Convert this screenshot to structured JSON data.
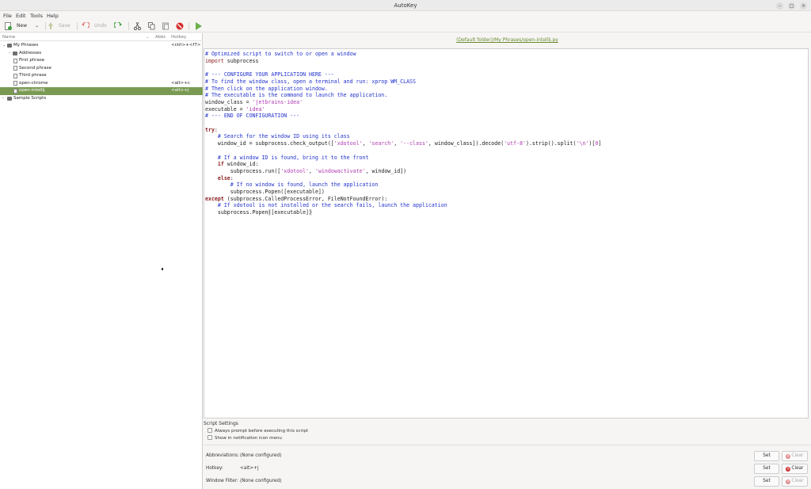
{
  "window": {
    "title": "AutoKey"
  },
  "menu": [
    "File",
    "Edit",
    "Tools",
    "Help"
  ],
  "toolbar": {
    "new_label": "New",
    "save_label": "Save",
    "undo_label": "Undo"
  },
  "tree": {
    "columns": {
      "name": "Name",
      "abbr": "Abbr.",
      "hotkey": "Hotkey"
    },
    "rows": [
      {
        "label": "My Phrases",
        "hotkey": "<ctrl>+<f7>"
      },
      {
        "label": "Addresses",
        "hotkey": ""
      },
      {
        "label": "First phrase",
        "hotkey": ""
      },
      {
        "label": "Second phrase",
        "hotkey": ""
      },
      {
        "label": "Third phrase",
        "hotkey": ""
      },
      {
        "label": "open-chrome",
        "hotkey": "<alt>+c"
      },
      {
        "label": "open-intellij",
        "hotkey": "<alt>+j"
      },
      {
        "label": "Sample Scripts",
        "hotkey": ""
      }
    ]
  },
  "editor": {
    "path": "(Default folder)/My Phrases/open-intellij.py"
  },
  "settings": {
    "title": "Script Settings",
    "always_prompt": "Always prompt before executing this script",
    "show_in_menu": "Show in notification icon menu",
    "abbreviations_label": "Abbreviations:",
    "abbreviations_value": "(None configured)",
    "hotkey_label": "Hotkey:",
    "hotkey_value": "<alt>+j",
    "window_filter_label": "Window Filter:",
    "window_filter_value": "(None configured)",
    "set_label": "Set",
    "clear_label": "Clear"
  },
  "colors": {
    "selection": "#7a9a53",
    "comment": "#2233cc",
    "keyword": "#8a1c1c",
    "string": "#b03bb0",
    "link": "#6a8a2f"
  }
}
